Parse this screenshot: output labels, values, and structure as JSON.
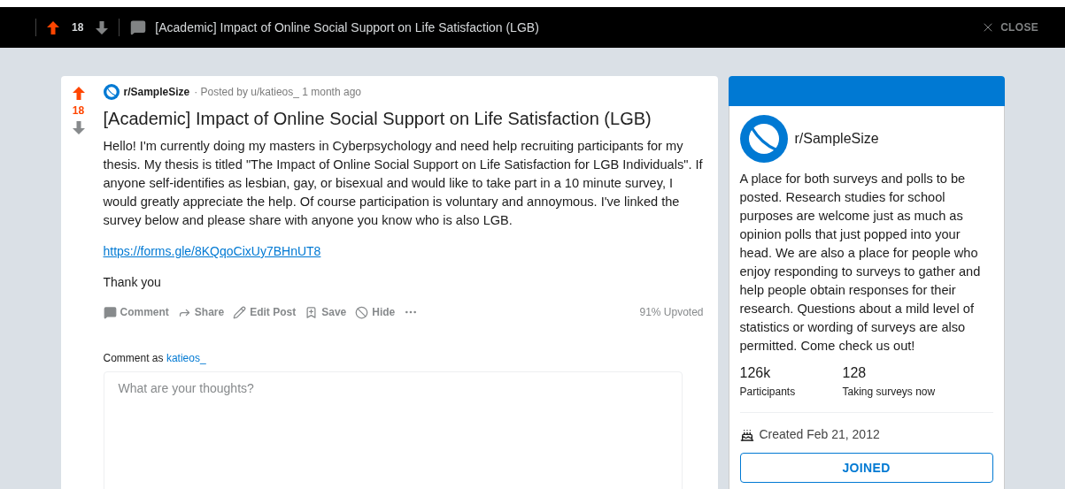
{
  "top_bar": {
    "score": "18",
    "up_selected": true,
    "down_selected": false,
    "title": "[Academic] Impact of Online Social Support on Life Satisfaction (LGB)",
    "close_label": "CLOSE"
  },
  "post": {
    "score": "18",
    "up_selected": true,
    "down_selected": false,
    "subreddit": "r/SampleSize",
    "meta": "· Posted by u/katieos_ 1 month ago",
    "title": "[Academic] Impact of Online Social Support on Life Satisfaction (LGB)",
    "body": "Hello! I'm currently doing my masters in Cyberpsychology and need help recruiting participants for my thesis. My thesis is titled \"The Impact of Online Social Support on Life Satisfaction for LGB Individuals\". If anyone self-identifies as lesbian, gay, or bisexual and would like to take part in a 10 minute survey, I would greatly appreciate the help. Of course participation is voluntary and annoymous. I've linked the survey below and please share with anyone you know who is also LGB.",
    "link": "https://forms.gle/8KQqoCixUy7BHnUT8",
    "closing": "Thank you",
    "actions": [
      {
        "kind": "comment",
        "label": "Comment"
      },
      {
        "kind": "share",
        "label": "Share"
      },
      {
        "kind": "edit",
        "label": "Edit Post"
      },
      {
        "kind": "save",
        "label": "Save"
      },
      {
        "kind": "hide",
        "label": "Hide"
      },
      {
        "kind": "more"
      }
    ],
    "upvoted": "91% Upvoted"
  },
  "comment": {
    "label": "Comment as",
    "user": "katieos_",
    "placeholder": "What are your thoughts?"
  },
  "sidebar": {
    "name": "r/SampleSize",
    "description": "A place for both surveys and polls to be posted. Research studies for school purposes are welcome just as much as opinion polls that just popped into your head. We are also a place for people who enjoy responding to surveys to gather and help people obtain responses for their research. Questions about a mild level of statistics or wording of surveys are also permitted. Come check us out!",
    "stats": [
      {
        "value": "126k",
        "label": "Participants"
      },
      {
        "value": "128",
        "label": "Taking surveys now"
      }
    ],
    "created": "Created Feb 21, 2012",
    "join_button": "JOINED"
  }
}
